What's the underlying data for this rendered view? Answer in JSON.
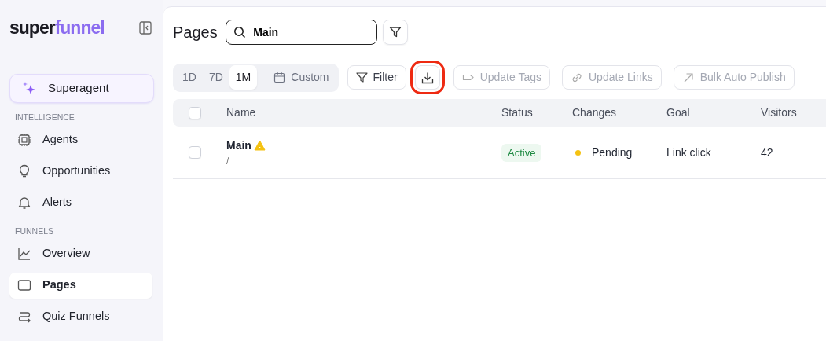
{
  "logo": {
    "dark": "super",
    "accent": "funnel"
  },
  "sidebar": {
    "superagent": "Superagent",
    "sections": [
      {
        "title": "INTELLIGENCE",
        "items": [
          {
            "label": "Agents",
            "selected": false
          },
          {
            "label": "Opportunities",
            "selected": false
          },
          {
            "label": "Alerts",
            "selected": false
          }
        ]
      },
      {
        "title": "FUNNELS",
        "items": [
          {
            "label": "Overview",
            "selected": false
          },
          {
            "label": "Pages",
            "selected": true
          },
          {
            "label": "Quiz Funnels",
            "selected": false
          }
        ]
      }
    ]
  },
  "page": {
    "title": "Pages",
    "search": {
      "value": "Main"
    }
  },
  "ranges": [
    {
      "label": "1D",
      "selected": false
    },
    {
      "label": "7D",
      "selected": false
    },
    {
      "label": "1M",
      "selected": true
    }
  ],
  "custom": "Custom",
  "filter": "Filter",
  "download": {
    "highlighted": true
  },
  "actions": [
    {
      "label": "Update Tags",
      "disabled": true
    },
    {
      "label": "Update Links",
      "disabled": true
    },
    {
      "label": "Bulk Auto Publish",
      "disabled": true
    }
  ],
  "table": {
    "all_checked": false,
    "columns": [
      "Name",
      "Status",
      "Changes",
      "Goal",
      "Visitors"
    ],
    "rows": [
      {
        "checked": false,
        "name": "Main",
        "warning": true,
        "path": "/",
        "status": "Active",
        "changes": "Pending",
        "goal": "Link click",
        "visitors": "42"
      }
    ]
  }
}
